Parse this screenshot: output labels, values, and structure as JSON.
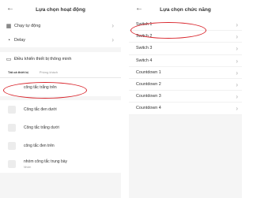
{
  "left": {
    "title": "Lựa chọn hoạt động",
    "menu": [
      {
        "icon": "▦",
        "label": "Chạy tự động"
      },
      {
        "icon": "◔",
        "label": "Delay"
      }
    ],
    "smart_control_label": "Điều khiển thiết bị thông minh",
    "tabs": [
      "Tất cả thiết bị",
      "Phòng khách"
    ],
    "devices": [
      {
        "name": "công tắc trắng trên",
        "sub": ""
      },
      {
        "name": "Công tắc đen dưới",
        "sub": ""
      },
      {
        "name": "Công tắc trắng dưới",
        "sub": ""
      },
      {
        "name": "công tắc đen trên",
        "sub": ""
      },
      {
        "name": "nhóm công tắc trung bày",
        "sub": "Nhóm"
      }
    ]
  },
  "right": {
    "title": "Lựa chọn chức năng",
    "functions": [
      "Switch 1",
      "Switch 2",
      "Switch 3",
      "Switch 4",
      "Countdown 1",
      "Countdown 2",
      "Countdown 3",
      "Countdown 4"
    ]
  },
  "icons": {
    "back": "←",
    "chevron": "›",
    "smart": "▭"
  },
  "colors": {
    "highlight": "#d9242b",
    "background": "#f5f5f5"
  }
}
